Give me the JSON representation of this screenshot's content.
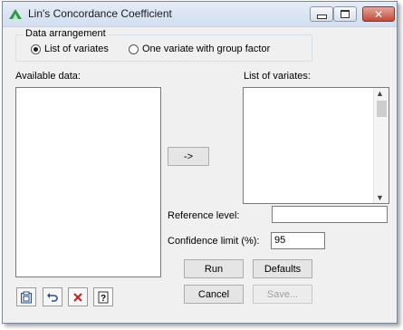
{
  "window": {
    "title": "Lin's Concordance Coefficient"
  },
  "arrangement": {
    "legend": "Data arrangement",
    "options": [
      "List of variates",
      "One variate with group factor"
    ],
    "selected": "List of variates"
  },
  "available": {
    "label": "Available data:"
  },
  "variates": {
    "label": "List of variates:"
  },
  "move_button": "->",
  "reference": {
    "label": "Reference level:",
    "value": ""
  },
  "confidence": {
    "label": "Confidence limit (%):",
    "value": "95"
  },
  "buttons": {
    "run": "Run",
    "defaults": "Defaults",
    "cancel": "Cancel",
    "save": "Save..."
  },
  "colors": {
    "accent_green": "#2e9a48",
    "close_red": "#c24a36"
  }
}
